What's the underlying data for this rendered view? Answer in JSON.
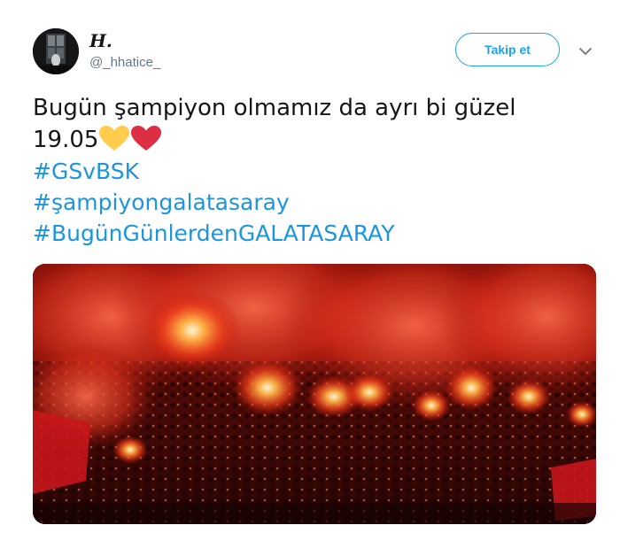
{
  "user": {
    "display_name": "H.",
    "screen_name": "@_hhatice_"
  },
  "actions": {
    "follow_label": "Takip et"
  },
  "tweet": {
    "line1": "Bugün şampiyon olmamız da ayrı bi güzel",
    "line2": "19.05",
    "emojis": [
      "yellow-heart",
      "red-heart"
    ],
    "hashtags": [
      "#GSvBSK",
      "#şampiyongalatasaray",
      "#BugünGünlerdenGALATASARAY"
    ]
  },
  "colors": {
    "link": "#1b95e0",
    "follow_border": "#1da1f2",
    "secondary_text": "#657786",
    "yellow_heart": "#ffcc4d",
    "red_heart": "#dd2e44"
  },
  "media": {
    "icon": "stadium-flares-photo"
  }
}
